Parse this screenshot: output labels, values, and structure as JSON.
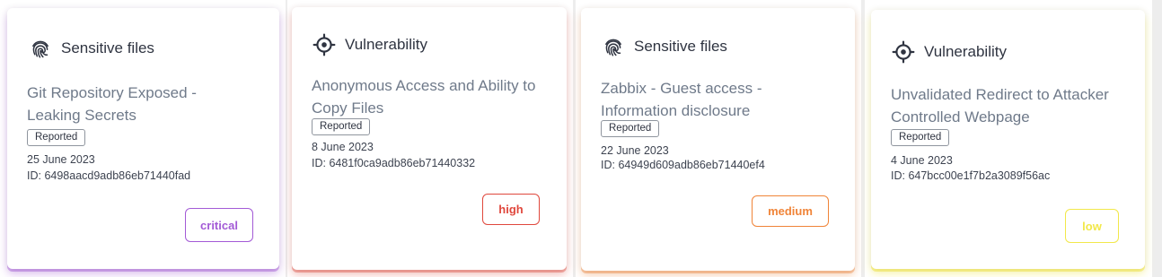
{
  "cards": [
    {
      "category": "Sensitive files",
      "category_icon": "fingerprint-icon",
      "title": "Git Repository Exposed - Leaking Secrets",
      "status": "Reported",
      "date": "25 June 2023",
      "id_text": "ID: 6498aacd9adb86eb71440fad",
      "severity": "critical",
      "severity_color": "#a35ad6"
    },
    {
      "category": "Vulnerability",
      "category_icon": "crosshair-icon",
      "title": "Anonymous Access and Ability to Copy Files",
      "status": "Reported",
      "date": "8 June 2023",
      "id_text": "ID: 6481f0ca9adb86eb71440332",
      "severity": "high",
      "severity_color": "#e0483d"
    },
    {
      "category": "Sensitive files",
      "category_icon": "fingerprint-icon",
      "title": "Zabbix - Guest access - Information disclosure",
      "status": "Reported",
      "date": "22 June 2023",
      "id_text": "ID: 64949d609adb86eb71440ef4",
      "severity": "medium",
      "severity_color": "#f08438"
    },
    {
      "category": "Vulnerability",
      "category_icon": "crosshair-icon",
      "title": "Unvalidated Redirect to Attacker Controlled Webpage",
      "status": "Reported",
      "date": "4 June 2023",
      "id_text": "ID: 647bcc00e1f7b2a3089f56ac",
      "severity": "low",
      "severity_color": "#f2e84a"
    }
  ]
}
